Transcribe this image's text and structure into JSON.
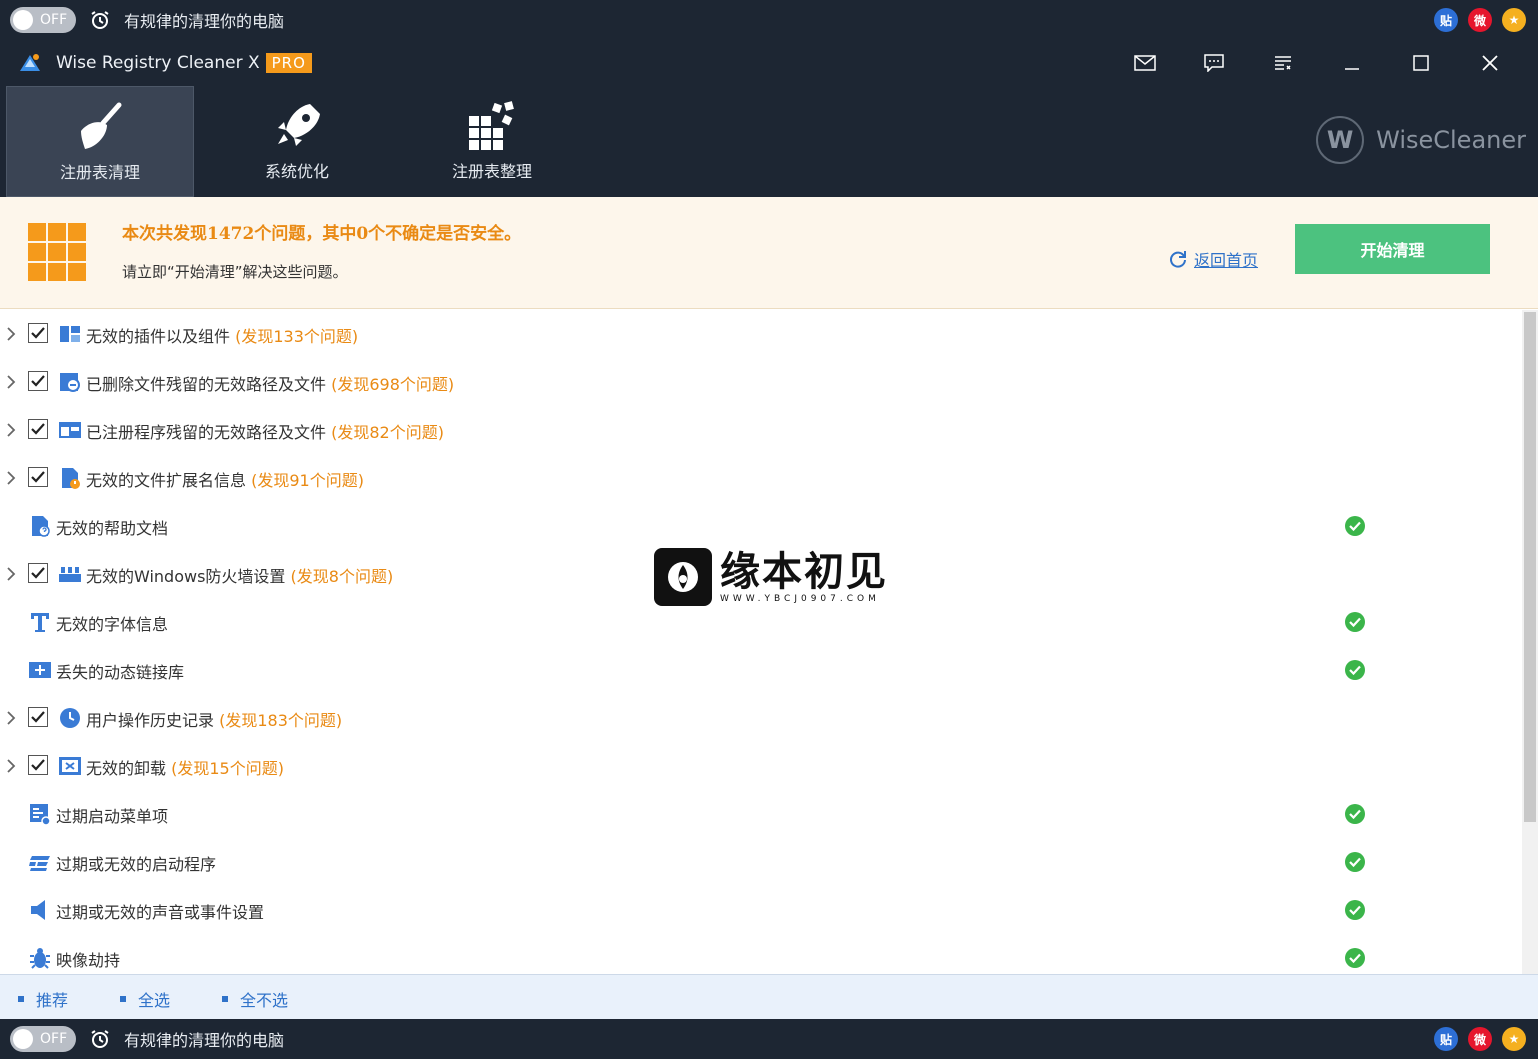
{
  "promo_bar": {
    "toggle_label": "OFF",
    "text": "有规律的清理你的电脑",
    "social": [
      "贴",
      "微",
      "★"
    ]
  },
  "titlebar": {
    "app_name": "Wise Registry Cleaner X",
    "badge": "PRO"
  },
  "nav": {
    "tabs": [
      {
        "label": "注册表清理",
        "icon": "broom-icon",
        "active": true
      },
      {
        "label": "系统优化",
        "icon": "rocket-icon",
        "active": false
      },
      {
        "label": "注册表整理",
        "icon": "defrag-blocks-icon",
        "active": false
      }
    ],
    "brand": "WiseCleaner",
    "brand_mark": "W"
  },
  "summary": {
    "title": "本次共发现1472个问题，其中0个不确定是否安全。",
    "subtitle": "请立即“开始清理”解决这些问题。",
    "back_link": "返回首页",
    "start_button": "开始清理"
  },
  "items": [
    {
      "label": "无效的插件以及组件",
      "count": "(发现133个问题)",
      "expandable": true,
      "checked": true,
      "ok": false,
      "icon": "plugin-icon"
    },
    {
      "label": "已删除文件残留的无效路径及文件",
      "count": "(发现698个问题)",
      "expandable": true,
      "checked": true,
      "ok": false,
      "icon": "deleted-file-icon"
    },
    {
      "label": "已注册程序残留的无效路径及文件",
      "count": "(发现82个问题)",
      "expandable": true,
      "checked": true,
      "ok": false,
      "icon": "program-window-icon"
    },
    {
      "label": "无效的文件扩展名信息",
      "count": "(发现91个问题)",
      "expandable": true,
      "checked": true,
      "ok": false,
      "icon": "file-extension-icon"
    },
    {
      "label": "无效的帮助文档",
      "count": "",
      "expandable": false,
      "checked": false,
      "ok": true,
      "icon": "help-doc-icon"
    },
    {
      "label": "无效的Windows防火墙设置",
      "count": "(发现8个问题)",
      "expandable": true,
      "checked": true,
      "ok": false,
      "icon": "firewall-icon"
    },
    {
      "label": "无效的字体信息",
      "count": "",
      "expandable": false,
      "checked": false,
      "ok": true,
      "icon": "font-icon"
    },
    {
      "label": "丢失的动态链接库",
      "count": "",
      "expandable": false,
      "checked": false,
      "ok": true,
      "icon": "dll-icon"
    },
    {
      "label": "用户操作历史记录",
      "count": "(发现183个问题)",
      "expandable": true,
      "checked": true,
      "ok": false,
      "icon": "history-clock-icon"
    },
    {
      "label": "无效的卸载",
      "count": "(发现15个问题)",
      "expandable": true,
      "checked": true,
      "ok": false,
      "icon": "uninstall-icon"
    },
    {
      "label": "过期启动菜单项",
      "count": "",
      "expandable": false,
      "checked": false,
      "ok": true,
      "icon": "start-menu-icon"
    },
    {
      "label": "过期或无效的启动程序",
      "count": "",
      "expandable": false,
      "checked": false,
      "ok": true,
      "icon": "startup-program-icon"
    },
    {
      "label": "过期或无效的声音或事件设置",
      "count": "",
      "expandable": false,
      "checked": false,
      "ok": true,
      "icon": "speaker-icon"
    },
    {
      "label": "映像劫持",
      "count": "",
      "expandable": false,
      "checked": false,
      "ok": true,
      "icon": "bug-icon"
    }
  ],
  "watermark": {
    "text": "缘本初见",
    "url": "WWW.YBCJ0907.COM"
  },
  "footer": {
    "links": [
      "推荐",
      "全选",
      "全不选"
    ]
  },
  "colors": {
    "dark_bg": "#1d2633",
    "accent_orange": "#f59a1b",
    "count_orange": "#e98a14",
    "start_green": "#4cc27f",
    "link_blue": "#2f72c9",
    "ok_green": "#3bb54a"
  }
}
